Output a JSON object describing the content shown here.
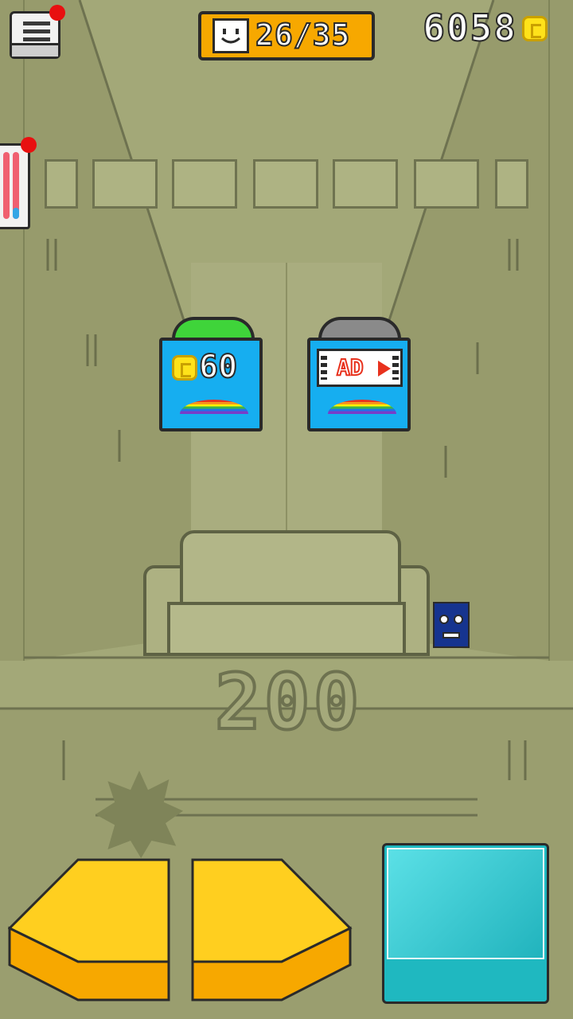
{
  "hud": {
    "menu_icon": "menu-list-icon",
    "progress_icon": "face-block-icon",
    "progress_text": "26/35",
    "coins": "6058",
    "coin_icon": "coin-icon",
    "energy_icon": "energy-gauge-icon"
  },
  "offers": [
    {
      "kind": "coins",
      "price": "60",
      "cap_color": "#3fd43a",
      "icon": "coin-icon",
      "trail_icon": "rainbow-trail-icon"
    },
    {
      "kind": "ad",
      "label": "AD",
      "cap_color": "#8a8a8a",
      "icon": "video-ad-icon",
      "trail_icon": "rainbow-trail-icon"
    }
  ],
  "level": {
    "floor_number": "200"
  },
  "controls": {
    "left_icon": "left-arrow-icon",
    "right_icon": "right-arrow-icon",
    "jump_icon": "jump-button-icon"
  },
  "colors": {
    "background": "#a3a878",
    "hud_orange": "#f7a800",
    "card_blue": "#16aef0",
    "jump_cyan": "#1fb8c0",
    "notification_red": "#e81010"
  }
}
